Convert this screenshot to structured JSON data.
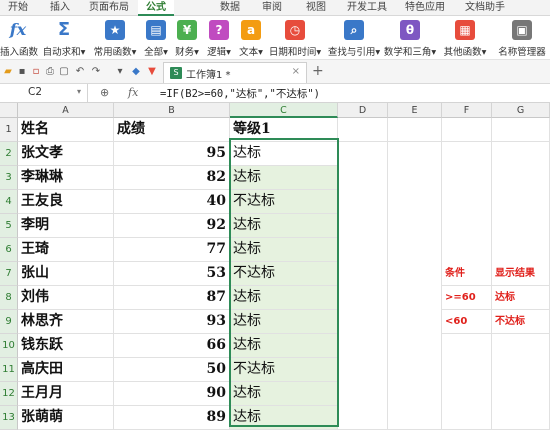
{
  "tabs": [
    "开始",
    "插入",
    "页面布局",
    "公式",
    "数据",
    "审阅",
    "视图",
    "开发工具",
    "特色应用",
    "文档助手"
  ],
  "active_tab": "公式",
  "ribbon": [
    {
      "label": "插入函数",
      "icon": "fx-icon",
      "color": "#3a78c8"
    },
    {
      "label": "自动求和▾",
      "icon": "sum-icon",
      "color": "#3a78c8"
    },
    {
      "label": "常用函数▾",
      "icon": "star-book-icon",
      "color": "#3a78c8"
    },
    {
      "label": "全部▾",
      "icon": "book-icon",
      "color": "#3a78c8"
    },
    {
      "label": "财务▾",
      "icon": "finance-book-icon",
      "color": "#4caf50"
    },
    {
      "label": "逻辑▾",
      "icon": "logic-book-icon",
      "color": "#c04bc0"
    },
    {
      "label": "文本▾",
      "icon": "text-book-icon",
      "color": "#f39c12"
    },
    {
      "label": "日期和时间▾",
      "icon": "clock-book-icon",
      "color": "#e74c3c"
    },
    {
      "label": "查找与引用▾",
      "icon": "search-book-icon",
      "color": "#3a78c8"
    },
    {
      "label": "数学和三角▾",
      "icon": "math-book-icon",
      "color": "#7e57c2"
    },
    {
      "label": "其他函数▾",
      "icon": "more-book-icon",
      "color": "#e74c3c"
    },
    {
      "label": "名称管理器",
      "icon": "name-manager-icon",
      "color": "#666666"
    }
  ],
  "doc_tab": {
    "name": "工作簿1 *",
    "close": "×"
  },
  "plus": "+",
  "namebox": "C2",
  "fx": "fx",
  "formula": "=IF(B2>=60,\"达标\",\"不达标\")",
  "columns": [
    "A",
    "B",
    "C",
    "D",
    "E",
    "F",
    "G"
  ],
  "rows": [
    "1",
    "2",
    "3",
    "4",
    "5",
    "6",
    "7",
    "8",
    "9",
    "10",
    "11",
    "12",
    "13"
  ],
  "header": {
    "a": "姓名",
    "b": "成绩",
    "c": "等级1"
  },
  "data": [
    {
      "name": "张文孝",
      "score": "95",
      "grade": "达标"
    },
    {
      "name": "李琳琳",
      "score": "82",
      "grade": "达标"
    },
    {
      "name": "王友良",
      "score": "40",
      "grade": "不达标"
    },
    {
      "name": "李明",
      "score": "92",
      "grade": "达标"
    },
    {
      "name": "王琦",
      "score": "77",
      "grade": "达标"
    },
    {
      "name": "张山",
      "score": "53",
      "grade": "不达标"
    },
    {
      "name": "刘伟",
      "score": "87",
      "grade": "达标"
    },
    {
      "name": "林思齐",
      "score": "93",
      "grade": "达标"
    },
    {
      "name": "钱东跃",
      "score": "66",
      "grade": "达标"
    },
    {
      "name": "高庆田",
      "score": "50",
      "grade": "不达标"
    },
    {
      "name": "王月月",
      "score": "90",
      "grade": "达标"
    },
    {
      "name": "张萌萌",
      "score": "89",
      "grade": "达标"
    }
  ],
  "side_table": [
    {
      "f": "条件",
      "g": "显示结果"
    },
    {
      "f": ">=60",
      "g": "达标"
    },
    {
      "f": "<60",
      "g": "不达标"
    }
  ],
  "colors": {
    "accent": "#2e8b57",
    "selection_fill": "#e6f2df",
    "red_text": "#e0201b"
  }
}
